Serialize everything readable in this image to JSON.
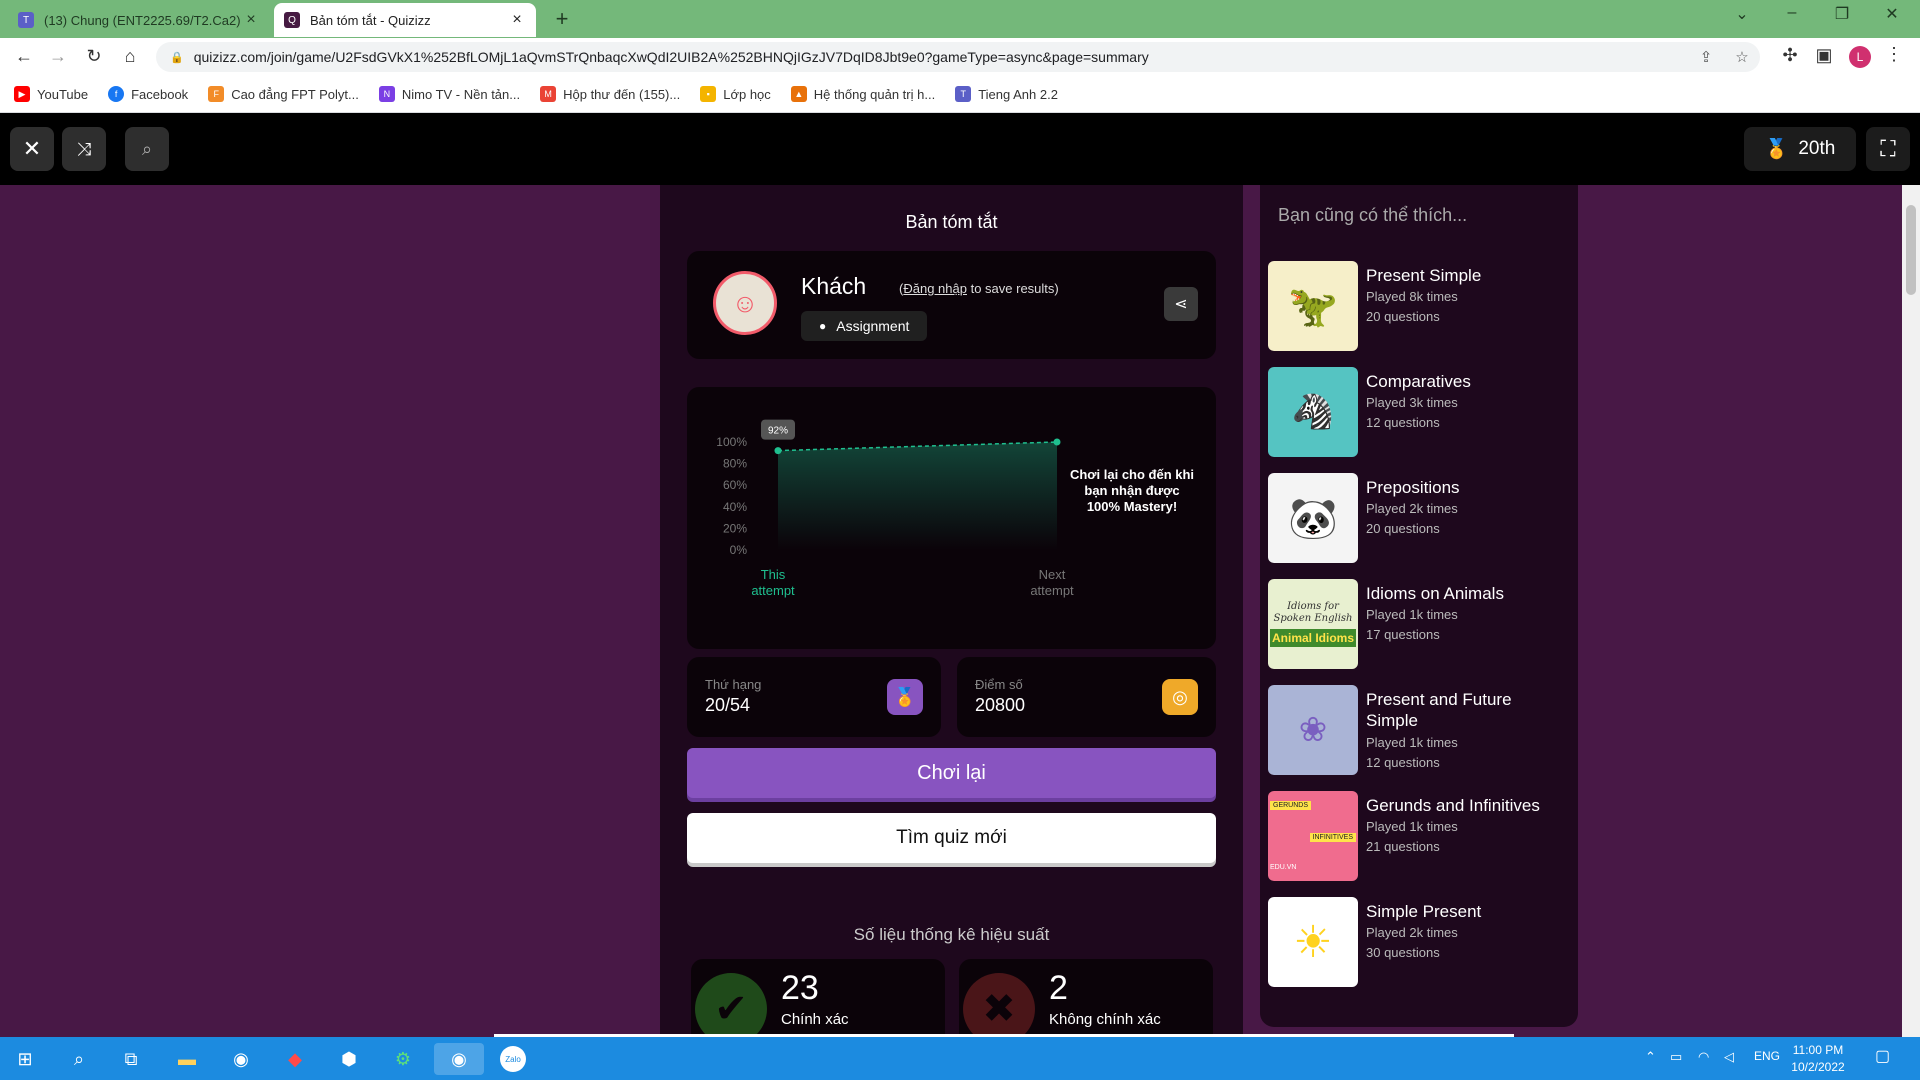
{
  "browser": {
    "tabs": [
      {
        "title": "(13) Chung (ENT2225.69/T2.Ca2)",
        "active": false,
        "favicon": "teams-icon"
      },
      {
        "title": "Bản tóm tắt - Quizizz",
        "active": true,
        "favicon": "quizizz-icon"
      }
    ],
    "new_tab": "+",
    "url": "quizizz.com/join/game/U2FsdGVkX1%252BfLOMjL1aQvmSTrQnbaqcXwQdI2UIB2A%252BHNQjIGzJV7DqID8Jbt9e0?gameType=async&page=summary",
    "profile_initial": "L",
    "bookmarks": [
      {
        "label": "YouTube",
        "color": "#ff0000"
      },
      {
        "label": "Facebook",
        "color": "#1877f2"
      },
      {
        "label": "Cao đẳng FPT Polyt...",
        "color": "#f28c28"
      },
      {
        "label": "Nimo TV - Nền tản...",
        "color": "#7b3fe4"
      },
      {
        "label": "Hộp thư đến (155)...",
        "color": "#ea4335"
      },
      {
        "label": "Lớp học",
        "color": "#f4b400"
      },
      {
        "label": "Hệ thống quản trị h...",
        "color": "#e8710a"
      },
      {
        "label": "Tieng Anh 2.2",
        "color": "#5b5fc7"
      }
    ]
  },
  "quiz_bar": {
    "rank_label": "20th"
  },
  "summary": {
    "title": "Bản tóm tắt",
    "profile": {
      "name": "Khách",
      "login_link": "Đăng nhập",
      "login_suffix": "to save results)",
      "login_prefix": "(",
      "chip": "Assignment"
    },
    "stats": {
      "rank_label": "Thứ hạng",
      "rank_value": "20/54",
      "score_label": "Điểm số",
      "score_value": "20800",
      "rank_color": "#8854c0",
      "score_color": "#efa929"
    },
    "play_again": "Chơi lại",
    "find_new": "Tìm quiz mới",
    "perf_title": "Số liệu thống kê hiệu suất",
    "correct": {
      "count": "23",
      "label": "Chính xác"
    },
    "incorrect": {
      "count": "2",
      "label": "Không chính xác"
    }
  },
  "chart_data": {
    "type": "line",
    "categories": [
      "This attempt",
      "Next attempt"
    ],
    "values": [
      92,
      100
    ],
    "ylim": [
      0,
      100
    ],
    "ytick_labels": [
      "100%",
      "80%",
      "60%",
      "40%",
      "20%",
      "0%"
    ],
    "data_label": "92%",
    "annotation": [
      "Chơi lại cho đến khi",
      "bạn nhận được",
      "100% Mastery!"
    ],
    "x_labels": [
      [
        "This",
        "attempt"
      ],
      [
        "Next",
        "attempt"
      ]
    ],
    "line_color": "#1fbf8f"
  },
  "recommendations": {
    "title": "Bạn cũng có thể thích...",
    "items": [
      {
        "name": "Present Simple",
        "played": "Played 8k times",
        "questions": "20 questions",
        "thumb_color": "#f6efc9"
      },
      {
        "name": "Comparatives",
        "played": "Played 3k times",
        "questions": "12 questions",
        "thumb_color": "#55c4c2"
      },
      {
        "name": "Prepositions",
        "played": "Played 2k times",
        "questions": "20 questions",
        "thumb_color": "#f4f4f4"
      },
      {
        "name": "Idioms on Animals",
        "played": "Played 1k times",
        "questions": "17 questions",
        "thumb_color": "#e8f0d0",
        "thumb_text": [
          "Idioms for Spoken English",
          "Animal Idioms"
        ]
      },
      {
        "name": "Present and Future Simple",
        "played": "Played 1k times",
        "questions": "12 questions",
        "thumb_color": "#aab4d6"
      },
      {
        "name": "Gerunds and Infinitives",
        "played": "Played 1k times",
        "questions": "21 questions",
        "thumb_color": "#f06c8e",
        "thumb_text": [
          "GERUNDS",
          "INFINITIVES",
          "EDU.VN"
        ]
      },
      {
        "name": "Simple Present",
        "played": "Played 2k times",
        "questions": "30 questions",
        "thumb_color": "#ffffff"
      }
    ]
  },
  "taskbar": {
    "language": "ENG",
    "time": "11:00 PM",
    "date": "10/2/2022"
  }
}
